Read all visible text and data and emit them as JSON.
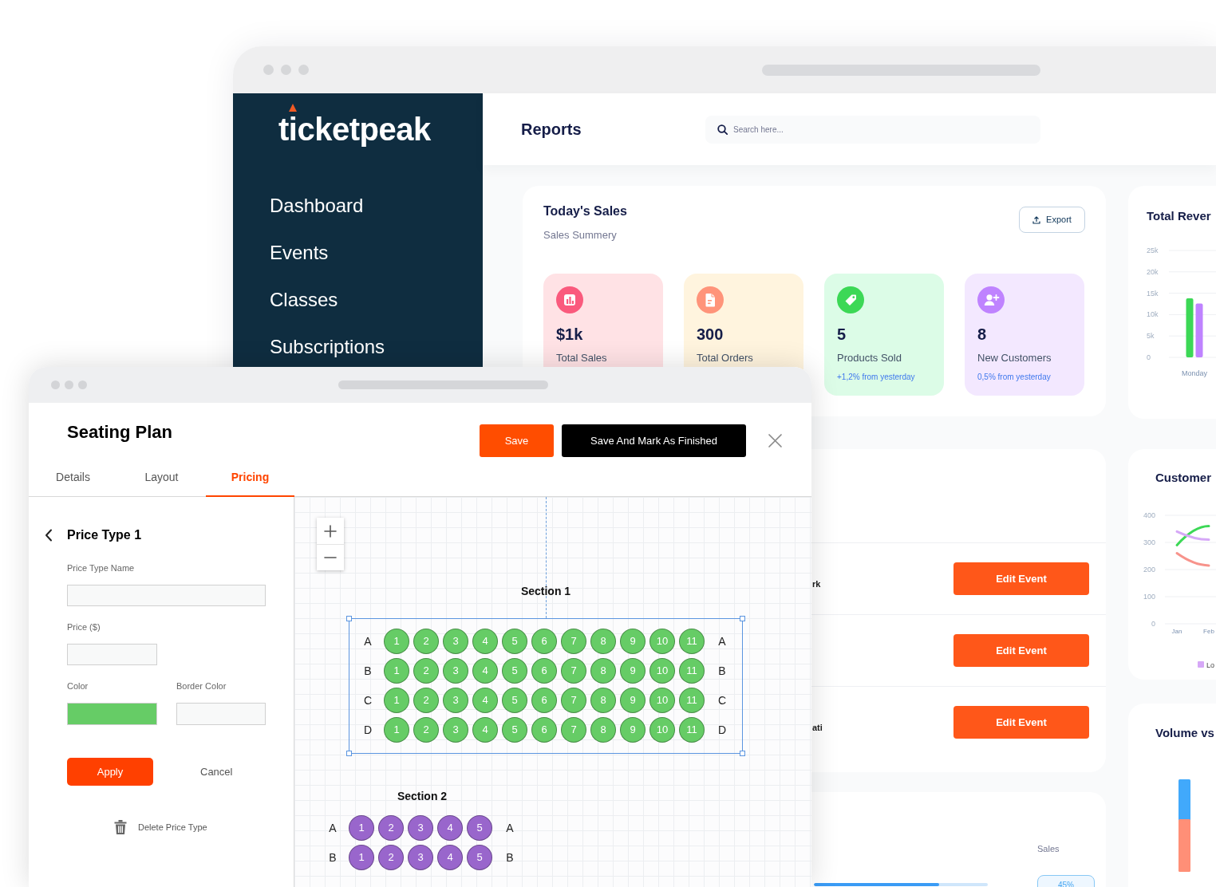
{
  "back_window": {
    "logo": "ticketpeak",
    "nav_items": [
      "Dashboard",
      "Events",
      "Classes",
      "Subscriptions"
    ],
    "header": {
      "title": "Reports",
      "search": {
        "placeholder": "Search here..."
      }
    },
    "todays_sales": {
      "title": "Today's Sales",
      "subtitle": "Sales Summery",
      "export_button": "Export",
      "stats": [
        {
          "kind": "sales",
          "color": "#fa5a7d",
          "value": "$1k",
          "label": "Total Sales"
        },
        {
          "kind": "orders",
          "color": "#ff947a",
          "value": "300",
          "label": "Total Orders"
        },
        {
          "kind": "products",
          "color": "#3cd856",
          "value": "5",
          "label": "Products Sold",
          "note": "+1,2% from yesterday"
        },
        {
          "kind": "customers",
          "color": "#bf83ff",
          "value": "8",
          "label": "New Customers",
          "note": "0,5% from yesterday"
        }
      ]
    },
    "events": {
      "rows": [
        {
          "column_1": "rk",
          "button": "Edit Event"
        },
        {
          "button": "Edit Event"
        },
        {
          "column_1": "ati",
          "button": "Edit Event"
        }
      ]
    },
    "sales_table": {
      "column_header": "Sales",
      "progress": {
        "level": 0.72
      },
      "badge": "45%"
    },
    "total_revenue": {
      "title": "Total Rever",
      "chart_data": {
        "type": "bar",
        "categories": [
          "Monday"
        ],
        "series": [
          {
            "color": "#3cd856",
            "values": [
              13800
            ]
          },
          {
            "color": "#bf83ff",
            "values": [
              12600
            ]
          }
        ],
        "ylim": [
          0,
          25000
        ],
        "yticks": [
          {
            "value": 0,
            "label": "0"
          },
          {
            "value": 5000,
            "label": "5k"
          },
          {
            "value": 10000,
            "label": "10k"
          },
          {
            "value": 15000,
            "label": "15k"
          },
          {
            "value": 20000,
            "label": "20k"
          },
          {
            "value": 25000,
            "label": "25k"
          }
        ],
        "grid": true
      }
    },
    "customer": {
      "title": "Customer",
      "chart_data": {
        "type": "line",
        "categories": [
          "Jan",
          "Feb"
        ],
        "series": [
          {
            "color": "#3cd856",
            "values": [
              290,
              360
            ]
          },
          {
            "name": "Lo",
            "color": "#d6a8f7",
            "values": [
              340,
              310
            ]
          },
          {
            "color": "#f7938b",
            "values": [
              260,
              215
            ]
          }
        ],
        "ylim": [
          0,
          400
        ],
        "yticks": [
          0,
          100,
          200,
          300,
          400
        ],
        "grid": true
      }
    },
    "volume": {
      "title": "Volume vs"
    }
  },
  "front_window": {
    "title": "Seating Plan",
    "buttons": [
      {
        "kind": "primary",
        "label": "Save"
      },
      {
        "kind": "dark",
        "label": "Save And Mark As Finished"
      }
    ],
    "tabs": [
      {
        "label": "Details",
        "selected": false
      },
      {
        "label": "Layout",
        "selected": false
      },
      {
        "label": "Pricing",
        "selected": true
      }
    ],
    "price_panel": {
      "title": "Price Type 1",
      "fields": [
        {
          "kind": "text",
          "label": "Price Type Name"
        },
        {
          "kind": "text",
          "label": "Price ($)"
        },
        {
          "kind": "color",
          "label": "Color",
          "color": "#66cc66"
        },
        {
          "kind": "color",
          "label": "Border Color"
        }
      ],
      "apply_button": "Apply",
      "cancel_button": "Cancel",
      "delete_button": "Delete Price Type"
    },
    "sections": [
      {
        "title": "Section 1",
        "color": "#66cc66",
        "selected": true,
        "rows": [
          {
            "left_label": "A",
            "right_label": "A",
            "seats": [
              "1",
              "2",
              "3",
              "4",
              "5",
              "6",
              "7",
              "8",
              "9",
              "10",
              "11"
            ]
          },
          {
            "left_label": "B",
            "right_label": "B",
            "seats": [
              "1",
              "2",
              "3",
              "4",
              "5",
              "6",
              "7",
              "8",
              "9",
              "10",
              "11"
            ]
          },
          {
            "left_label": "C",
            "right_label": "C",
            "seats": [
              "1",
              "2",
              "3",
              "4",
              "5",
              "6",
              "7",
              "8",
              "9",
              "10",
              "11"
            ]
          },
          {
            "left_label": "D",
            "right_label": "D",
            "seats": [
              "1",
              "2",
              "3",
              "4",
              "5",
              "6",
              "7",
              "8",
              "9",
              "10",
              "11"
            ]
          }
        ]
      },
      {
        "title": "Section 2",
        "color": "#9966cc",
        "selected": false,
        "rows": [
          {
            "left_label": "A",
            "right_label": "A",
            "seats": [
              "1",
              "2",
              "3",
              "4",
              "5"
            ]
          },
          {
            "left_label": "B",
            "right_label": "B",
            "seats": [
              "1",
              "2",
              "3",
              "4",
              "5"
            ]
          }
        ]
      }
    ]
  }
}
